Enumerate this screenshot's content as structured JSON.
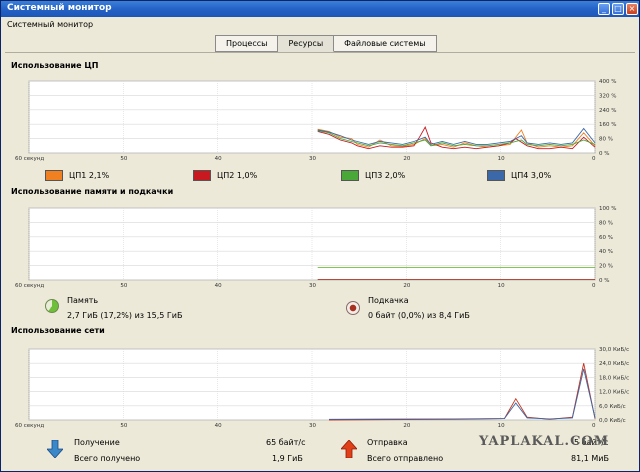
{
  "window": {
    "title": "Системный монитор"
  },
  "menubar": {
    "label": "Системный монитор"
  },
  "tabs": [
    {
      "label": "Процессы",
      "active": false
    },
    {
      "label": "Ресурсы",
      "active": true
    },
    {
      "label": "Файловые системы",
      "active": false
    }
  ],
  "cpu": {
    "section_title": "Использование ЦП",
    "y_ticks": [
      "400 %",
      "320 %",
      "240 %",
      "160 %",
      "80 %",
      "0 %"
    ],
    "x_ticks": [
      "60 секунд",
      "50",
      "40",
      "30",
      "20",
      "10",
      "0"
    ],
    "legend": [
      {
        "label": "ЦП1",
        "value": "2,1%",
        "color": "#f08020"
      },
      {
        "label": "ЦП2",
        "value": "1,0%",
        "color": "#c81820"
      },
      {
        "label": "ЦП3",
        "value": "2,0%",
        "color": "#4aa838"
      },
      {
        "label": "ЦП4",
        "value": "3,0%",
        "color": "#3a68a8"
      }
    ]
  },
  "memory": {
    "section_title": "Использование памяти и подкачки",
    "y_ticks": [
      "100 %",
      "80 %",
      "60 %",
      "40 %",
      "20 %",
      "0 %"
    ],
    "x_ticks": [
      "60 секунд",
      "50",
      "40",
      "30",
      "20",
      "10",
      "0"
    ],
    "ram_label": "Память",
    "ram_value": "2,7 ГиБ (17,2%) из 15,5 ГиБ",
    "swap_label": "Подкачка",
    "swap_value": "0 байт (0,0%) из 8,4 ГиБ",
    "ram_color": "#6fbf3a",
    "swap_color": "#a83020"
  },
  "network": {
    "section_title": "Использование сети",
    "y_ticks": [
      "30,0 КиБ/с",
      "24,0 КиБ/с",
      "18,0 КиБ/с",
      "12,0 КиБ/с",
      "6,0 КиБ/с",
      "0,0 КиБ/с"
    ],
    "x_ticks": [
      "60 секунд",
      "50",
      "40",
      "30",
      "20",
      "10",
      "0"
    ],
    "receive_label": "Получение",
    "receive_rate": "65 байт/с",
    "total_received_label": "Всего получено",
    "total_received": "1,9 ГиБ",
    "send_label": "Отправка",
    "send_rate": "5 байт/с",
    "total_sent_label": "Всего отправлено",
    "total_sent": "81,1 МиБ",
    "receive_color": "#3a68a8",
    "send_color": "#c83018"
  },
  "watermark": "YAPLAKAL.COM"
}
